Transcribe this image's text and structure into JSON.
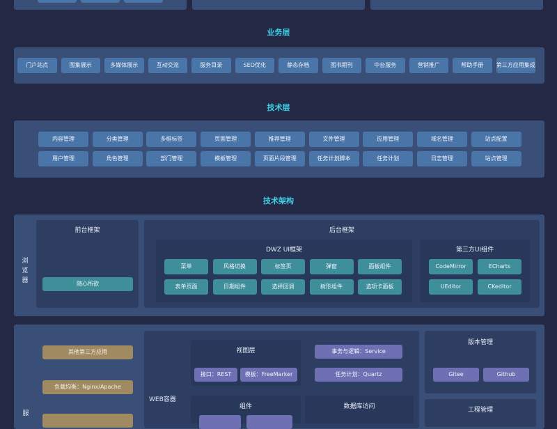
{
  "sections": {
    "business": "业务层",
    "tech": "技术层",
    "arch": "技术架构"
  },
  "business_items": [
    "门户站点",
    "图集展示",
    "多媒体展示",
    "互动交流",
    "服务目录",
    "SEO优化",
    "静态存档",
    "图书期刊",
    "中台服务",
    "营销推广",
    "帮助手册",
    "第三方应用集成"
  ],
  "tech_row1": [
    "内容管理",
    "分类管理",
    "多维标签",
    "页面管理",
    "推荐管理",
    "文件管理",
    "应用管理",
    "域名管理",
    "站点配置"
  ],
  "tech_row2": [
    "用户管理",
    "角色管理",
    "部门管理",
    "模板管理",
    "页面片段管理",
    "任务计划脚本",
    "任务计划",
    "日志管理",
    "站点管理"
  ],
  "browser": {
    "label": "浏览器",
    "front": {
      "title": "前台框架",
      "item": "随心所欲"
    },
    "back": {
      "title": "后台框架",
      "dwz": {
        "title": "DWZ UI框架",
        "items": [
          "菜单",
          "风格切换",
          "标签页",
          "弹窗",
          "面板组件",
          "表单页面",
          "日期组件",
          "选择回调",
          "树形组件",
          "选项卡面板"
        ]
      },
      "third": {
        "title": "第三方UI组件",
        "items": [
          "CodeMirror",
          "ECharts",
          "UEditor",
          "CKeditor"
        ]
      }
    }
  },
  "server": {
    "label": "服",
    "left_items": [
      "其他第三方应用",
      "负载均衡：Nginx/Apache"
    ],
    "web_container": "WEB容器",
    "view_layer": {
      "title": "视图层",
      "items": [
        "接口：REST",
        "模板：FreeMarker"
      ]
    },
    "service_items": [
      "事务与逻辑：Service",
      "任务计划：Quartz"
    ],
    "component_title": "组件",
    "db_title": "数据库访问",
    "version": {
      "title": "版本管理",
      "items": [
        "Gitee",
        "Github"
      ]
    },
    "project": {
      "title": "工程管理"
    }
  }
}
